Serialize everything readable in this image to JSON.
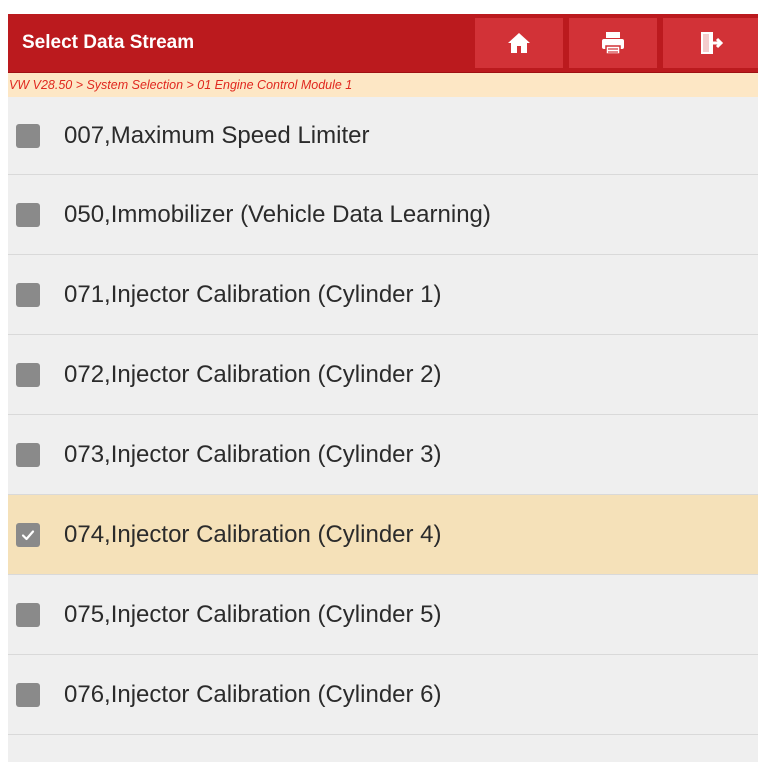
{
  "header": {
    "title": "Select Data Stream",
    "buttons": [
      {
        "name": "home",
        "icon": "home-icon"
      },
      {
        "name": "print",
        "icon": "print-icon"
      },
      {
        "name": "exit",
        "icon": "exit-icon"
      }
    ]
  },
  "breadcrumb": "VW V28.50 > System Selection > 01 Engine Control Module 1",
  "colors": {
    "header_bg": "#bb1a1e",
    "header_button_bg": "#d23237",
    "breadcrumb_bg": "#fde7c5",
    "breadcrumb_text": "#e0281f",
    "selected_row_bg": "#f5e1b9",
    "list_bg": "#efefef"
  },
  "items": [
    {
      "label": "007,Maximum Speed Limiter",
      "checked": false
    },
    {
      "label": "050,Immobilizer (Vehicle Data Learning)",
      "checked": false
    },
    {
      "label": "071,Injector Calibration (Cylinder 1)",
      "checked": false
    },
    {
      "label": "072,Injector Calibration (Cylinder 2)",
      "checked": false
    },
    {
      "label": "073,Injector Calibration (Cylinder 3)",
      "checked": false
    },
    {
      "label": "074,Injector Calibration (Cylinder 4)",
      "checked": true
    },
    {
      "label": "075,Injector Calibration (Cylinder 5)",
      "checked": false
    },
    {
      "label": "076,Injector Calibration (Cylinder 6)",
      "checked": false
    }
  ]
}
